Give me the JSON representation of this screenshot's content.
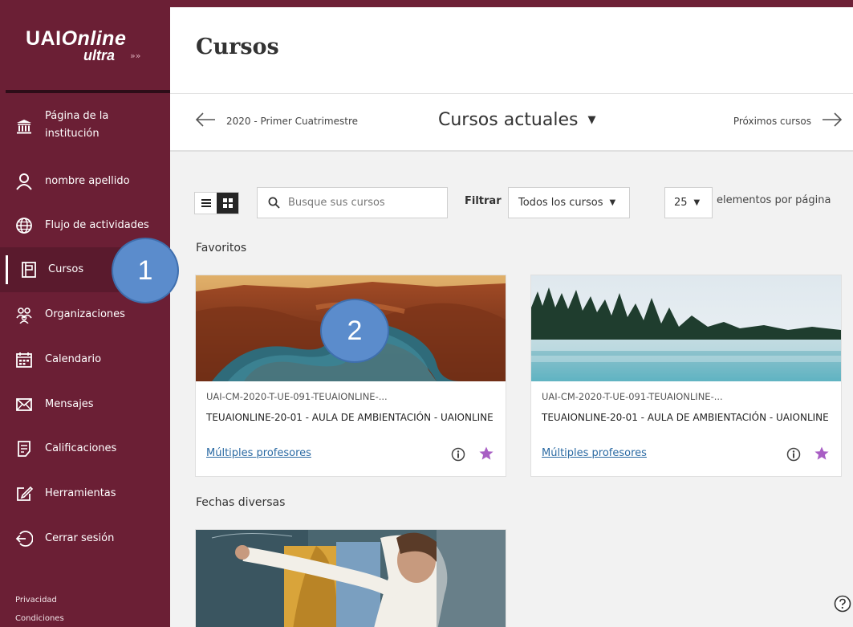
{
  "app": {
    "logo_main": "UAIOnline",
    "logo_sub": "ultra"
  },
  "sidebar": {
    "items": [
      {
        "label": "Página de la institución",
        "icon": "institution-icon"
      },
      {
        "label": "nombre apellido",
        "icon": "user-icon"
      },
      {
        "label": "Flujo de actividades",
        "icon": "globe-icon"
      },
      {
        "label": "Cursos",
        "icon": "courses-icon",
        "active": true
      },
      {
        "label": "Organizaciones",
        "icon": "organizations-icon"
      },
      {
        "label": "Calendario",
        "icon": "calendar-icon"
      },
      {
        "label": "Mensajes",
        "icon": "mail-icon"
      },
      {
        "label": "Calificaciones",
        "icon": "grades-icon"
      },
      {
        "label": "Herramientas",
        "icon": "tools-icon"
      },
      {
        "label": "Cerrar sesión",
        "icon": "logout-icon"
      }
    ],
    "footer": {
      "privacy": "Privacidad",
      "terms": "Condiciones"
    }
  },
  "callouts": {
    "one": "1",
    "two": "2"
  },
  "header": {
    "title": "Cursos"
  },
  "term_nav": {
    "prev": "2020 - Primer Cuatrimestre",
    "current": "Cursos actuales",
    "next": "Próximos cursos"
  },
  "toolbar": {
    "search_placeholder": "Busque sus cursos",
    "filter_label": "Filtrar",
    "filter_value": "Todos los cursos",
    "per_page_value": "25",
    "per_page_label": "elementos por página"
  },
  "sections": {
    "favorites": "Favoritos",
    "various": "Fechas diversas"
  },
  "courses": [
    {
      "code": "UAI-CM-2020-T-UE-091-TEUAIONLINE-...",
      "name": "TEUAIONLINE-20-01 - AULA DE AMBIENTACIÓN - UAIONLINE",
      "instructors": "Múltiples profesores",
      "cover": "canyon-river",
      "favorite_color": "#a85ec4"
    },
    {
      "code": "UAI-CM-2020-T-UE-091-TEUAIONLINE-...",
      "name": "TEUAIONLINE-20-01 - AULA DE AMBIENTACIÓN - UAIONLINE",
      "instructors": "Múltiples profesores",
      "cover": "forest-lake",
      "favorite_color": "#a85ec4"
    }
  ],
  "colors": {
    "sidebar": "#6b1f35",
    "accent_link": "#2b6aa3",
    "callout": "#5b8ccc"
  }
}
